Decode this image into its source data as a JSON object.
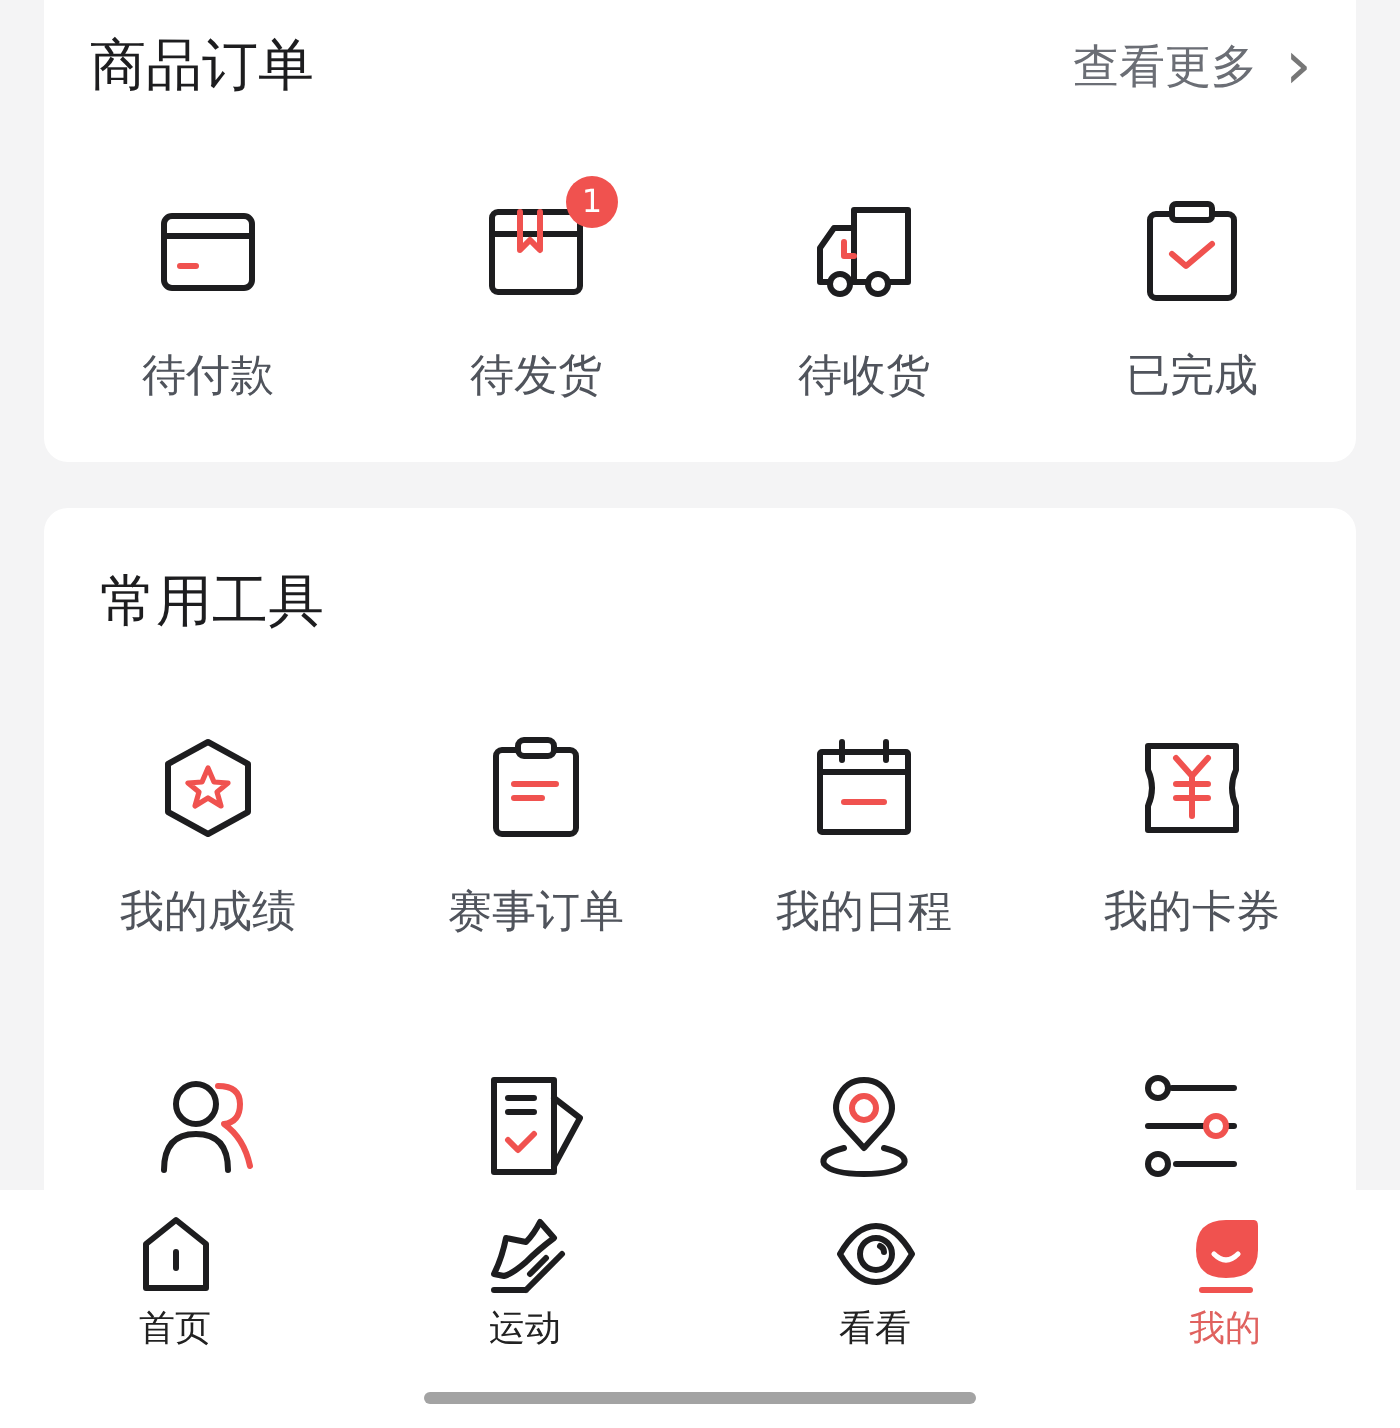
{
  "orders": {
    "title": "商品订单",
    "more": "查看更多",
    "more_arrow": "›",
    "items": [
      {
        "label": "待付款"
      },
      {
        "label": "待发货",
        "badge": "1"
      },
      {
        "label": "待收货"
      },
      {
        "label": "已完成"
      }
    ]
  },
  "tools": {
    "title": "常用工具",
    "items": [
      {
        "label": "我的成绩"
      },
      {
        "label": "赛事订单"
      },
      {
        "label": "我的日程"
      },
      {
        "label": "我的卡券"
      }
    ]
  },
  "tab_bar": [
    {
      "label": "首页",
      "selected": false
    },
    {
      "label": "运动",
      "selected": false
    },
    {
      "label": "看看",
      "selected": false
    },
    {
      "label": "我的",
      "selected": true
    }
  ]
}
